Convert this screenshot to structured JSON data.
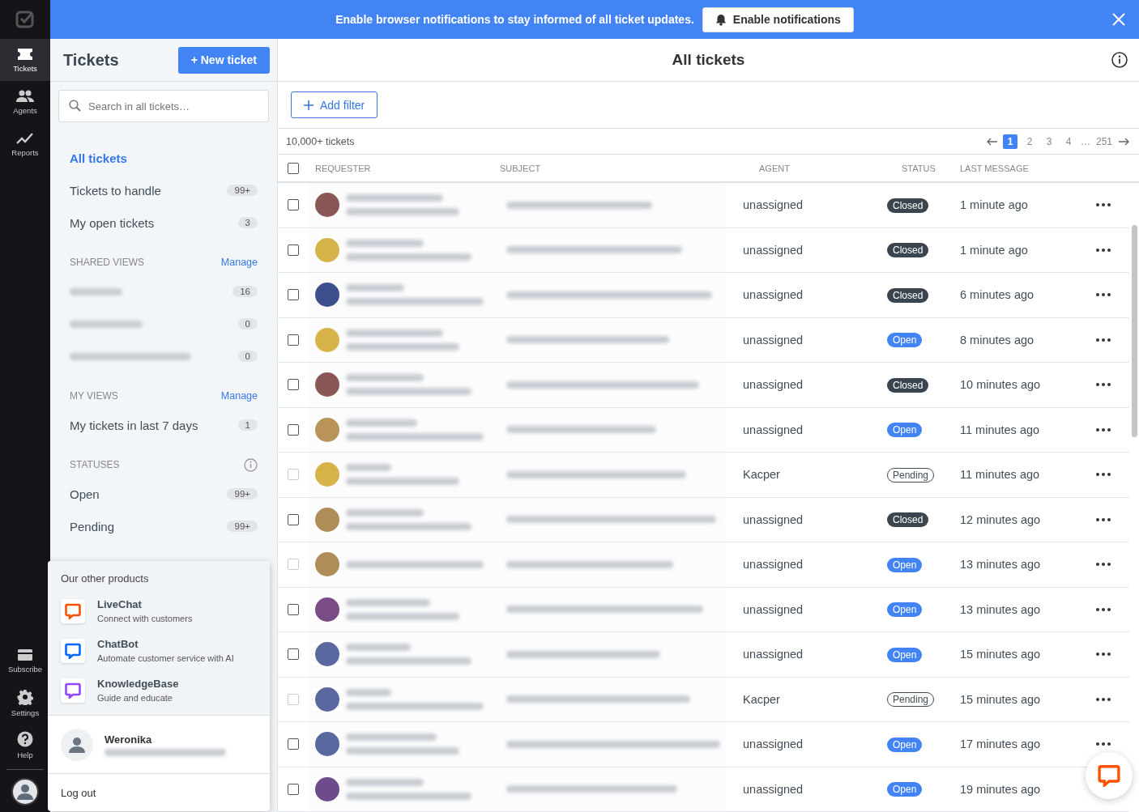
{
  "banner": {
    "text": "Enable browser notifications to stay informed of all ticket updates.",
    "button": "Enable notifications"
  },
  "rail": {
    "items": [
      {
        "label": "Tickets",
        "selected": true
      },
      {
        "label": "Agents",
        "selected": false
      },
      {
        "label": "Reports",
        "selected": false
      }
    ],
    "bottom": [
      {
        "label": "Subscribe"
      },
      {
        "label": "Settings"
      },
      {
        "label": "Help"
      }
    ]
  },
  "sidebar": {
    "title": "Tickets",
    "new_button": "+ New ticket",
    "search": {
      "placeholder": "Search in all tickets…"
    },
    "views": [
      {
        "label": "All tickets",
        "selected": true
      },
      {
        "label": "Tickets to handle",
        "count": "99+",
        "selected": false
      },
      {
        "label": "My open tickets",
        "count": "3",
        "selected": false
      }
    ],
    "sections": [
      {
        "heading": "SHARED VIEWS",
        "action": "Manage",
        "items": [
          {
            "count": "16"
          },
          {
            "count": "0"
          },
          {
            "count": "0"
          }
        ]
      },
      {
        "heading": "MY VIEWS",
        "action": "Manage",
        "items": [
          {
            "label": "My tickets in last 7 days",
            "count": "1"
          }
        ]
      },
      {
        "heading": "STATUSES",
        "items": [
          {
            "label": "Open",
            "count": "99+"
          },
          {
            "label": "Pending",
            "count": "99+"
          }
        ]
      }
    ]
  },
  "products_menu": {
    "heading": "Our other products",
    "products": [
      {
        "name": "LiveChat",
        "desc": "Connect with customers",
        "color": "#ff5100"
      },
      {
        "name": "ChatBot",
        "desc": "Automate customer service with AI",
        "color": "#0066ff"
      },
      {
        "name": "KnowledgeBase",
        "desc": "Guide and educate",
        "color": "#9146ff"
      }
    ],
    "user": {
      "name": "Weronika"
    },
    "logout": "Log out"
  },
  "main": {
    "title": "All tickets",
    "add_filter": "Add filter",
    "count": "10,000+ tickets",
    "pages": [
      {
        "label": "1",
        "selected": true
      },
      {
        "label": "2",
        "selected": false
      },
      {
        "label": "3",
        "selected": false
      },
      {
        "label": "4",
        "selected": false
      }
    ],
    "ellipsis": "…",
    "last_page": {
      "label": "251",
      "selected": false
    },
    "select_all": {
      "checked": false
    },
    "columns": [
      "REQUESTER",
      "SUBJECT",
      "AGENT",
      "STATUS",
      "LAST MESSAGE"
    ],
    "rows": [
      {
        "color": "#8a5656",
        "disabled": false,
        "agent": "unassigned",
        "status": {
          "label": "Closed",
          "kind": "closed"
        },
        "last": "1 minute ago"
      },
      {
        "color": "#d6b44a",
        "disabled": false,
        "agent": "unassigned",
        "status": {
          "label": "Closed",
          "kind": "closed"
        },
        "last": "1 minute ago"
      },
      {
        "color": "#3e4f8e",
        "disabled": false,
        "agent": "unassigned",
        "status": {
          "label": "Closed",
          "kind": "closed"
        },
        "last": "6 minutes ago"
      },
      {
        "color": "#d6b44a",
        "disabled": false,
        "agent": "unassigned",
        "status": {
          "label": "Open",
          "kind": "open"
        },
        "last": "8 minutes ago"
      },
      {
        "color": "#8a5656",
        "disabled": false,
        "agent": "unassigned",
        "status": {
          "label": "Closed",
          "kind": "closed"
        },
        "last": "10 minutes ago"
      },
      {
        "color": "#b8945a",
        "disabled": false,
        "agent": "unassigned",
        "status": {
          "label": "Open",
          "kind": "open"
        },
        "last": "11 minutes ago"
      },
      {
        "color": "#d6b44a",
        "disabled": true,
        "agent": "Kacper",
        "status": {
          "label": "Pending",
          "kind": "pending"
        },
        "last": "11 minutes ago"
      },
      {
        "color": "#b08d58",
        "disabled": false,
        "agent": "unassigned",
        "status": {
          "label": "Closed",
          "kind": "closed"
        },
        "last": "12 minutes ago"
      },
      {
        "color": "#b08d58",
        "disabled": true,
        "agent": "unassigned",
        "status": {
          "label": "Open",
          "kind": "open"
        },
        "last": "13 minutes ago"
      },
      {
        "color": "#7a4c86",
        "disabled": false,
        "agent": "unassigned",
        "status": {
          "label": "Open",
          "kind": "open"
        },
        "last": "13 minutes ago"
      },
      {
        "color": "#5a68a0",
        "disabled": false,
        "agent": "unassigned",
        "status": {
          "label": "Open",
          "kind": "open"
        },
        "last": "15 minutes ago"
      },
      {
        "color": "#5a68a0",
        "disabled": true,
        "agent": "Kacper",
        "status": {
          "label": "Pending",
          "kind": "pending"
        },
        "last": "15 minutes ago"
      },
      {
        "color": "#5a68a0",
        "disabled": false,
        "agent": "unassigned",
        "status": {
          "label": "Open",
          "kind": "open"
        },
        "last": "17 minutes ago"
      },
      {
        "color": "#6c4c8c",
        "disabled": false,
        "agent": "unassigned",
        "status": {
          "label": "Open",
          "kind": "open"
        },
        "last": "19 minutes ago"
      }
    ]
  }
}
